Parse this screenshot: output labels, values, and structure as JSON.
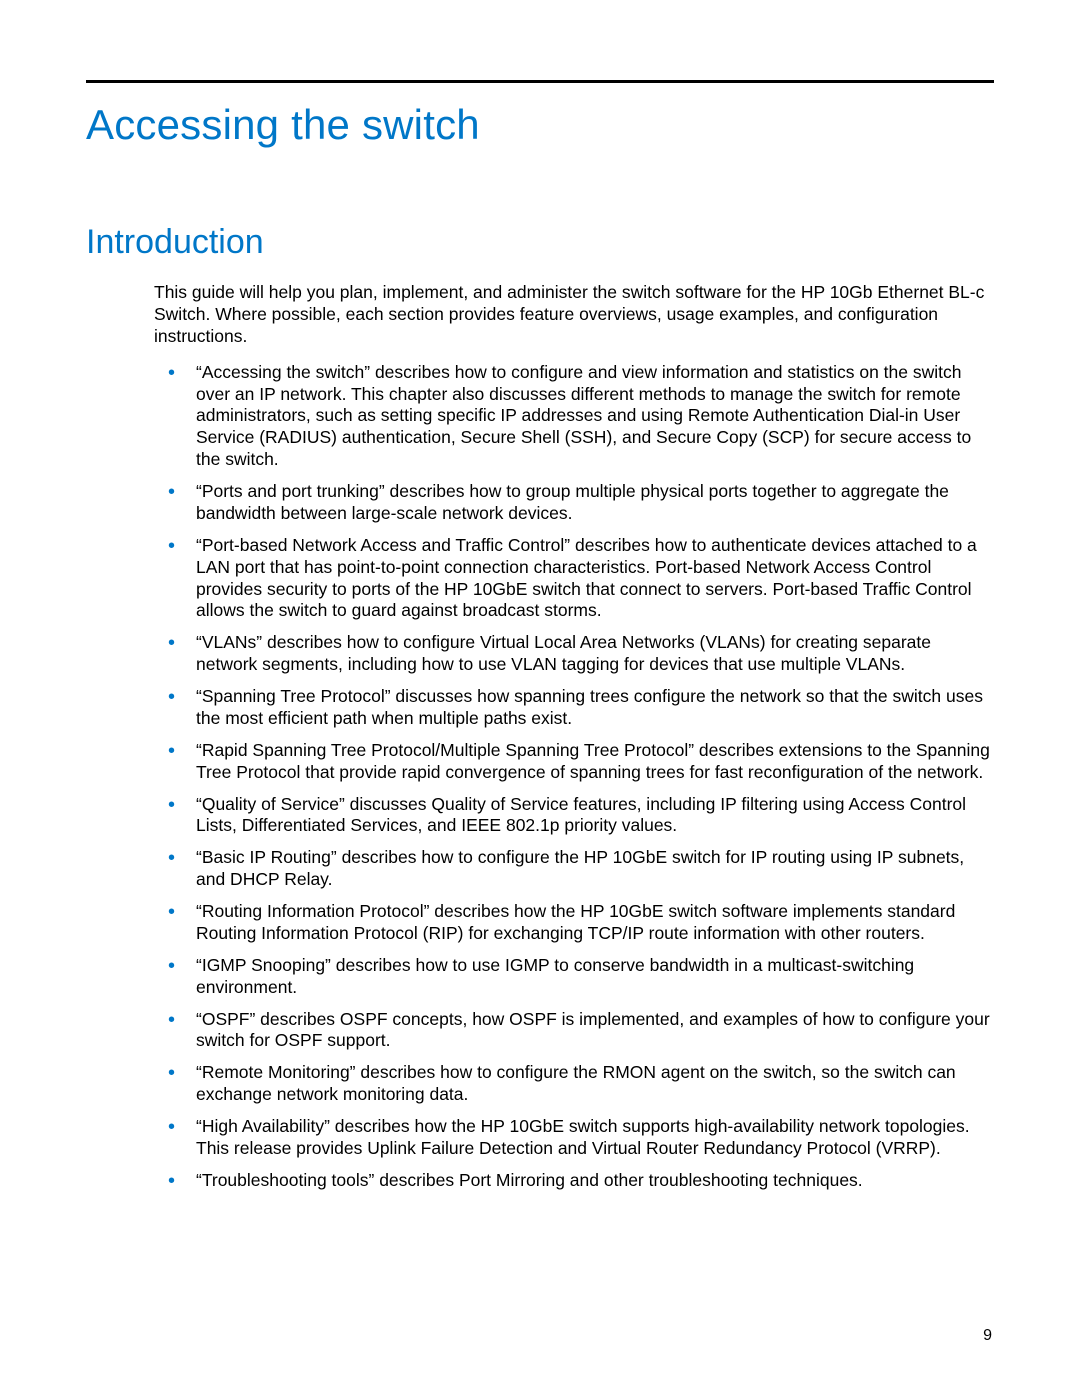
{
  "title": "Accessing the switch",
  "section_heading": "Introduction",
  "intro_paragraph": "This guide will help you plan, implement, and administer the switch software for the HP 10Gb Ethernet BL-c Switch. Where possible, each section provides feature overviews, usage examples, and configuration instructions.",
  "bullets": [
    "“Accessing the switch” describes how to configure and view information and statistics on the switch over an IP network. This chapter also discusses different methods to manage the switch for remote administrators, such as setting specific IP addresses and using Remote Authentication Dial-in User Service (RADIUS) authentication, Secure Shell (SSH), and Secure Copy (SCP) for secure access to the switch.",
    "“Ports and port trunking” describes how to group multiple physical ports together to aggregate the bandwidth between large-scale network devices.",
    "“Port-based Network Access and Traffic Control” describes how to authenticate devices attached to a LAN port that has point-to-point connection characteristics. Port-based Network Access Control provides security to ports of the HP 10GbE switch that connect to servers. Port-based Traffic Control allows the switch to guard against broadcast storms.",
    "“VLANs” describes how to configure Virtual Local Area Networks (VLANs) for creating separate network segments, including how to use VLAN tagging for devices that use multiple VLANs.",
    "“Spanning Tree Protocol” discusses how spanning trees configure the network so that the switch uses the most efficient path when multiple paths exist.",
    "“Rapid Spanning Tree Protocol/Multiple Spanning Tree Protocol” describes extensions to the Spanning Tree Protocol that provide rapid convergence of spanning trees for fast reconfiguration of the network.",
    "“Quality of Service” discusses Quality of Service features, including IP filtering using Access Control Lists, Differentiated Services, and IEEE 802.1p priority values.",
    "“Basic IP Routing” describes how to configure the HP 10GbE switch for IP routing using IP subnets, and DHCP Relay.",
    " “Routing Information Protocol” describes how the HP 10GbE switch software implements standard Routing Information Protocol (RIP) for exchanging TCP/IP route information with other routers.",
    "“IGMP Snooping” describes how to use IGMP to conserve bandwidth in a multicast-switching environment.",
    "“OSPF” describes OSPF concepts, how OSPF is implemented, and examples of how to configure your switch for OSPF support.",
    "“Remote Monitoring” describes how to configure the RMON agent on the switch, so the switch can exchange network monitoring data.",
    "“High Availability” describes how the HP 10GbE switch supports high-availability network topologies. This release provides Uplink Failure Detection and Virtual Router Redundancy Protocol (VRRP).",
    "“Troubleshooting tools” describes Port Mirroring and other troubleshooting techniques."
  ],
  "page_number": "9",
  "colors": {
    "accent": "#0077c8"
  }
}
